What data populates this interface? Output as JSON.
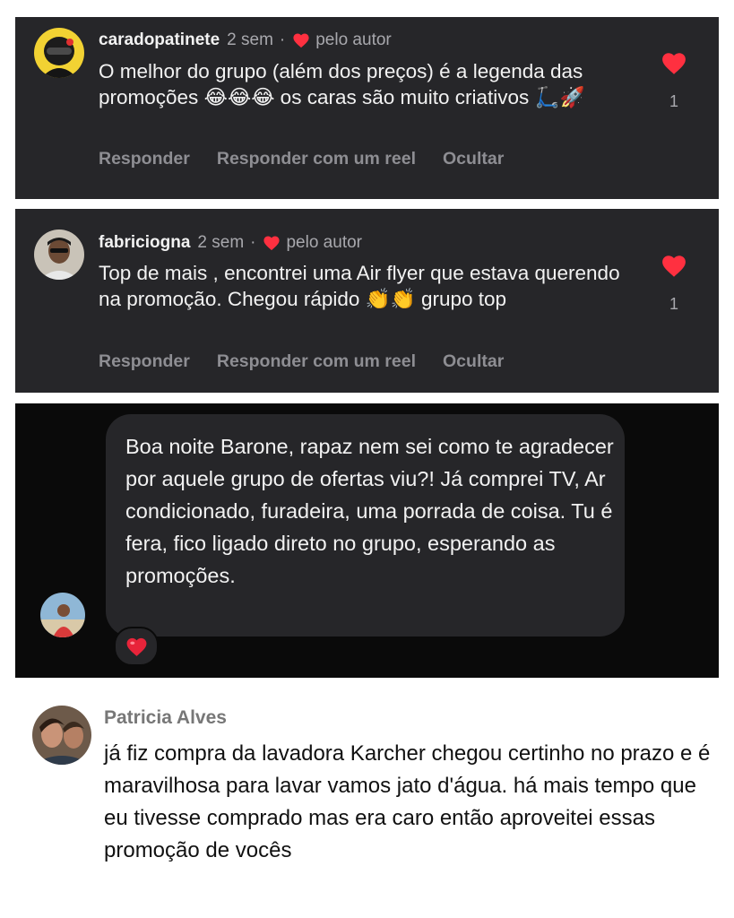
{
  "comments": [
    {
      "username": "caradopatinete",
      "time": "2 sem",
      "separator": "·",
      "author_liked": "pelo autor",
      "text": "O melhor do grupo (além dos preços) é a legenda das promoções 😂😂😂 os caras são muito criativos 🛴🚀",
      "like_count": "1",
      "actions": [
        "Responder",
        "Responder com um reel",
        "Ocultar"
      ]
    },
    {
      "username": "fabriciogna",
      "time": "2 sem",
      "separator": "·",
      "author_liked": "pelo autor",
      "text": "Top de mais , encontrei uma Air flyer que estava querendo na promoção. Chegou rápido 👏👏 grupo top",
      "like_count": "1",
      "actions": [
        "Responder",
        "Responder com um reel",
        "Ocultar"
      ]
    }
  ],
  "direct_message": {
    "text": "Boa noite Barone, rapaz nem sei como te agradecer por aquele grupo de ofertas viu?! Já comprei TV, Ar condicionado, furadeira, uma porrada de coisa. Tu é fera, fico ligado direto no grupo, esperando as promoções.",
    "reaction": "heart-reaction"
  },
  "facebook_comment": {
    "name": "Patricia Alves",
    "text": "já fiz compra da lavadora Karcher chegou certinho no prazo e é maravilhosa para lavar vamos jato d'água. há mais tempo que eu tivesse comprado mas era caro então aproveitei essas promoção de vocês"
  },
  "colors": {
    "card_bg": "#262629",
    "dm_bg": "#0a0a0a",
    "heart": "#ff3040",
    "muted": "#a8a8ad"
  }
}
